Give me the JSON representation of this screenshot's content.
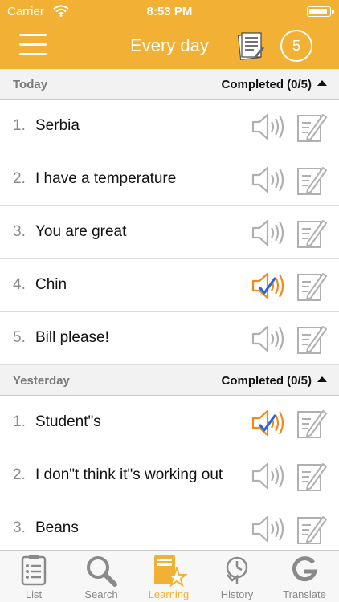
{
  "status_bar": {
    "carrier": "Carrier",
    "time": "8:53 PM"
  },
  "header": {
    "title": "Every day",
    "badge": "5"
  },
  "sections": [
    {
      "label": "Today",
      "status": "Completed (0/5)",
      "items": [
        {
          "num": "1.",
          "text": "Serbia",
          "audio_done": false
        },
        {
          "num": "2.",
          "text": "I have a temperature",
          "audio_done": false
        },
        {
          "num": "3.",
          "text": "You are great",
          "audio_done": false
        },
        {
          "num": "4.",
          "text": "Chin",
          "audio_done": true
        },
        {
          "num": "5.",
          "text": "Bill please!",
          "audio_done": false
        }
      ]
    },
    {
      "label": "Yesterday",
      "status": "Completed (0/5)",
      "items": [
        {
          "num": "1.",
          "text": "Student\"s",
          "audio_done": true
        },
        {
          "num": "2.",
          "text": "I don\"t think it\"s working out",
          "audio_done": false
        },
        {
          "num": "3.",
          "text": "Beans",
          "audio_done": false
        }
      ]
    }
  ],
  "tabs": [
    {
      "label": "List",
      "icon": "clipboard-list-icon",
      "active": false
    },
    {
      "label": "Search",
      "icon": "magnifier-icon",
      "active": false
    },
    {
      "label": "Learning",
      "icon": "book-star-icon",
      "active": true
    },
    {
      "label": "History",
      "icon": "history-clock-icon",
      "active": false
    },
    {
      "label": "Translate",
      "icon": "google-g-icon",
      "active": false
    }
  ],
  "colors": {
    "accent": "#f2b134",
    "audio_done": "#f08a1c",
    "check": "#2563eb",
    "icon_gray": "#b0b0b0"
  }
}
